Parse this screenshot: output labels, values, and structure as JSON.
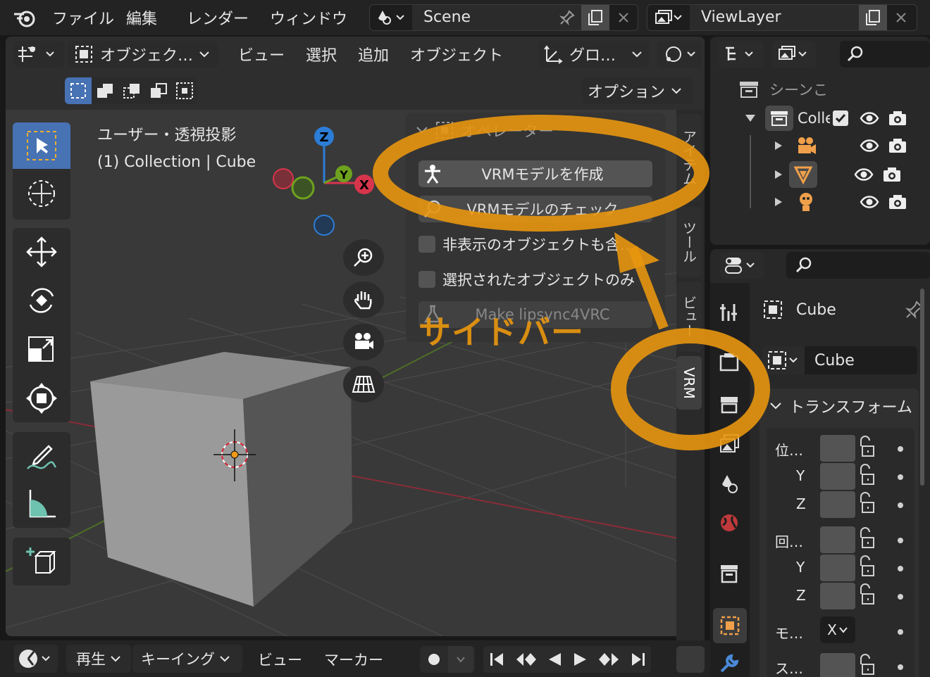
{
  "topbar": {
    "menus": [
      "ファイル",
      "編集",
      "レンダー",
      "ウィンドウ"
    ],
    "scene_name": "Scene",
    "viewlayer_name": "ViewLayer"
  },
  "viewport_header": {
    "mode": "オブジェク…",
    "menus": [
      "ビュー",
      "選択",
      "追加",
      "オブジェクト"
    ],
    "transform_orientation": "グロ…",
    "options_label": "オプション"
  },
  "viewport": {
    "view_name": "ユーザー・透視投影",
    "collection_info": "(1) Collection | Cube",
    "gizmo_axes": [
      "Z",
      "Y",
      "X"
    ]
  },
  "sidebar": {
    "tabs": [
      "アイテム",
      "ツール",
      "ビュー",
      "VRM"
    ],
    "active_tab": "VRM",
    "operator_header": "オペレーター",
    "create_vrm_button": "VRMモデルを作成",
    "check_vrm_button": "VRMモデルのチェック",
    "include_hidden_label": "非表示のオブジェクトも含…",
    "selected_only_label": "選択されたオブジェクトのみ",
    "lipsync_button": "Make lipsync4VRC"
  },
  "annotation": {
    "sidebar_label": "サイドバー",
    "accent_color": "#e8960f"
  },
  "outliner": {
    "scene_label": "シーンこ",
    "collection_label": "Colle"
  },
  "properties": {
    "object_name": "Cube",
    "data_name": "Cube",
    "transform_header": "トランスフォーム",
    "location_label": "位…",
    "rotation_label": "回…",
    "mode_label": "モ…",
    "scale_label": "ス…",
    "axis_y": "Y",
    "axis_z": "Z",
    "rotation_mode_value": "X"
  },
  "timeline": {
    "playback_label": "再生",
    "keying_label": "キーイング",
    "view_label": "ビュー",
    "marker_label": "マーカー"
  },
  "colors": {
    "accent_blue": "#4772b3",
    "axis_x": "#d7354b",
    "axis_y": "#6ea21e",
    "axis_z": "#2c7dd6"
  }
}
